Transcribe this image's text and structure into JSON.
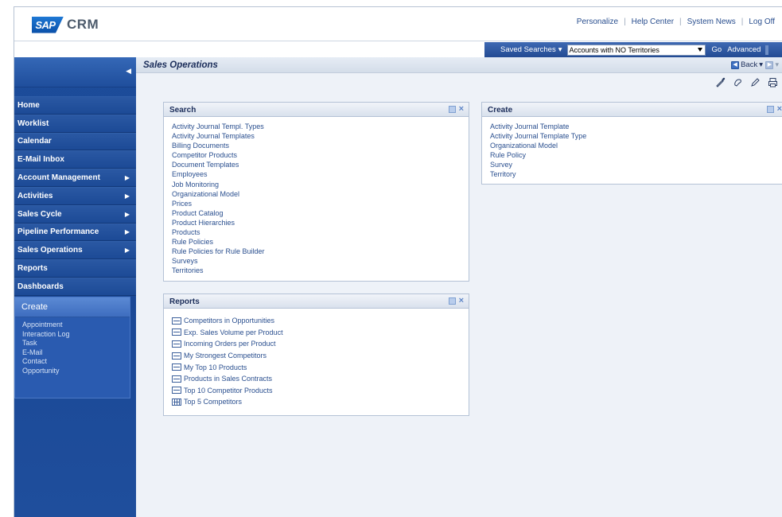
{
  "header": {
    "logo_brand": "SAP",
    "logo_product": "CRM",
    "links": [
      "Personalize",
      "Help Center",
      "System News",
      "Log Off"
    ]
  },
  "saved_search": {
    "label": "Saved Searches",
    "selected": "Accounts with NO Territories",
    "go_label": "Go",
    "advanced_label": "Advanced"
  },
  "sidebar": {
    "nav": [
      {
        "label": "Home",
        "has_children": false
      },
      {
        "label": "Worklist",
        "has_children": false
      },
      {
        "label": "Calendar",
        "has_children": false
      },
      {
        "label": "E-Mail Inbox",
        "has_children": false
      },
      {
        "label": "Account Management",
        "has_children": true
      },
      {
        "label": "Activities",
        "has_children": true
      },
      {
        "label": "Sales Cycle",
        "has_children": true
      },
      {
        "label": "Pipeline Performance",
        "has_children": true
      },
      {
        "label": "Sales Operations",
        "has_children": true
      },
      {
        "label": "Reports",
        "has_children": false
      },
      {
        "label": "Dashboards",
        "has_children": false
      }
    ],
    "create": {
      "title": "Create",
      "items": [
        "Appointment",
        "Interaction Log",
        "Task",
        "E-Mail",
        "Contact",
        "Opportunity"
      ]
    }
  },
  "main": {
    "title": "Sales Operations",
    "back_label": "Back",
    "search_panel": {
      "title": "Search",
      "items": [
        "Activity Journal Templ. Types",
        "Activity Journal Templates",
        "Billing Documents",
        "Competitor Products",
        "Document Templates",
        "Employees",
        "Job Monitoring",
        "Organizational Model",
        "Prices",
        "Product Catalog",
        "Product Hierarchies",
        "Products",
        "Rule Policies",
        "Rule Policies for Rule Builder",
        "Surveys",
        "Territories"
      ]
    },
    "create_panel": {
      "title": "Create",
      "items": [
        "Activity Journal Template",
        "Activity Journal Template Type",
        "Organizational Model",
        "Rule Policy",
        "Survey",
        "Territory"
      ]
    },
    "reports_panel": {
      "title": "Reports",
      "items": [
        {
          "label": "Competitors in Opportunities",
          "icon": "report-icon"
        },
        {
          "label": "Exp. Sales Volume per Product",
          "icon": "report-icon"
        },
        {
          "label": "Incoming Orders per Product",
          "icon": "report-icon"
        },
        {
          "label": "My Strongest Competitors",
          "icon": "report-icon"
        },
        {
          "label": "My Top 10 Products",
          "icon": "report-icon"
        },
        {
          "label": "Products in Sales Contracts",
          "icon": "report-icon"
        },
        {
          "label": "Top 10 Competitor Products",
          "icon": "report-icon"
        },
        {
          "label": "Top 5 Competitors",
          "icon": "grid-report-icon"
        }
      ]
    }
  }
}
